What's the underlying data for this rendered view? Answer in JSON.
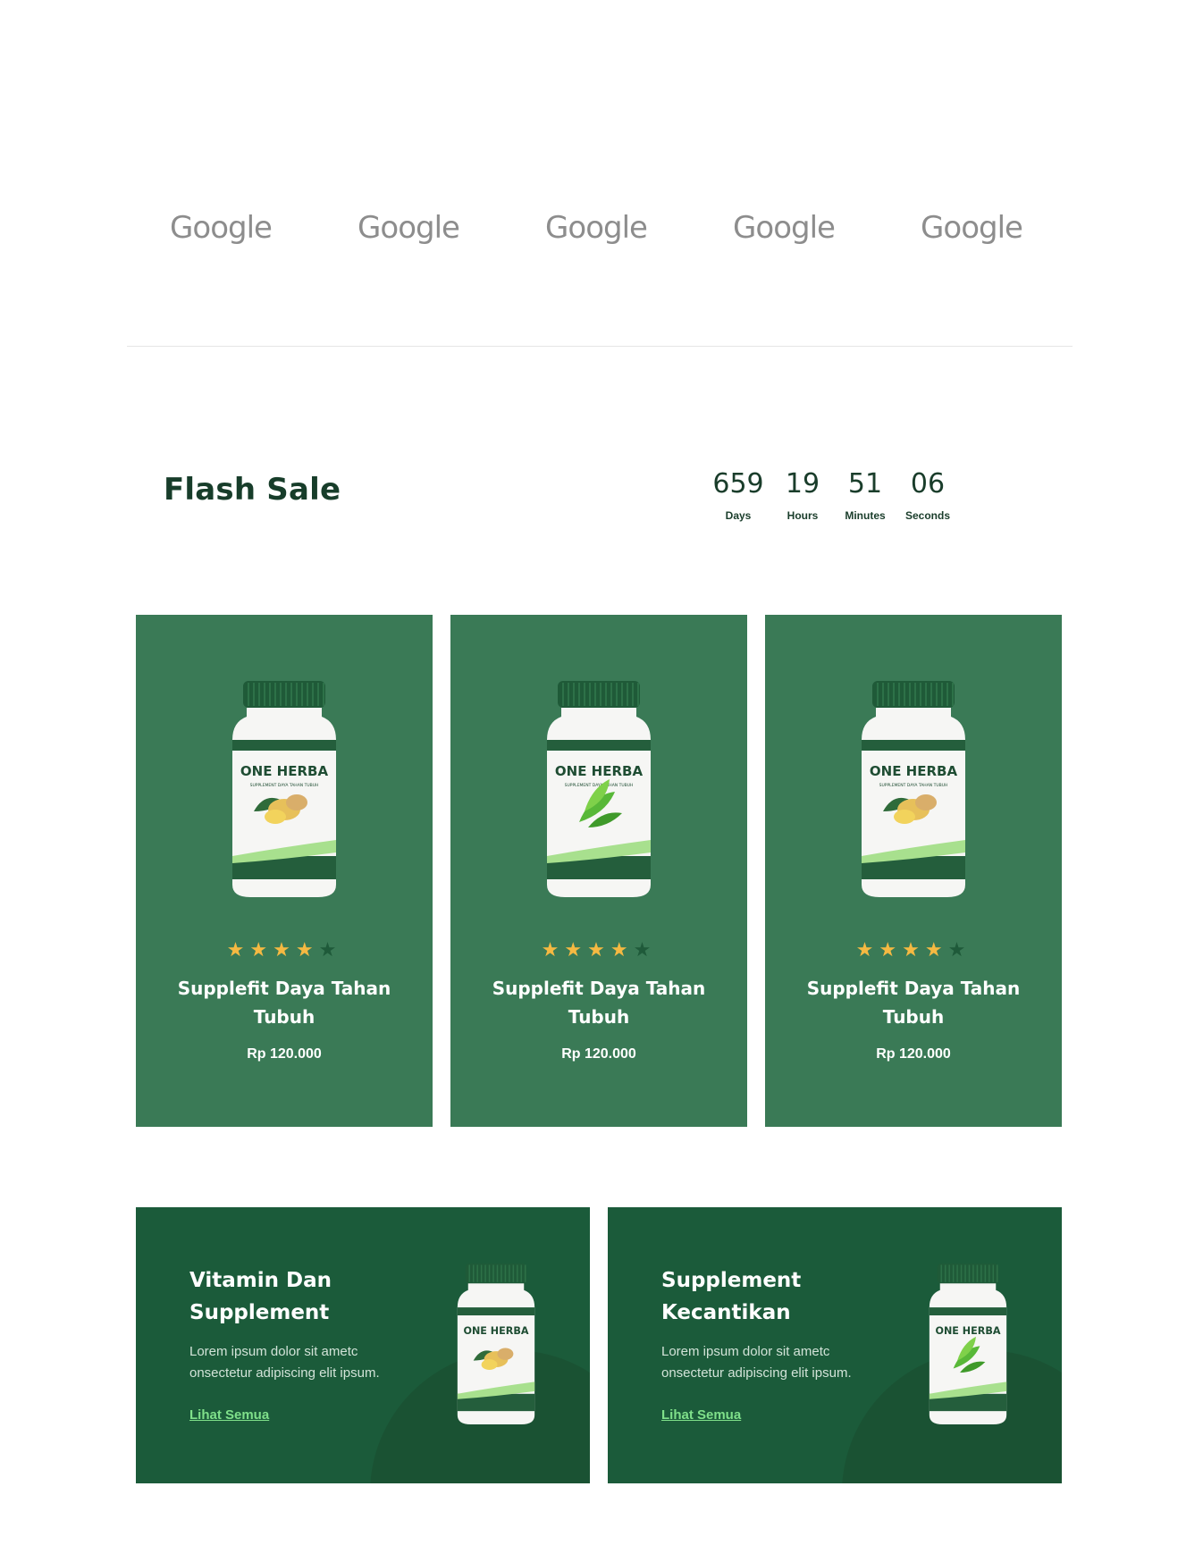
{
  "partners": {
    "logos": [
      "Google",
      "Google",
      "Google",
      "Google",
      "Google"
    ]
  },
  "flash_sale": {
    "title": "Flash Sale",
    "countdown": [
      {
        "value": "659",
        "label": "Days"
      },
      {
        "value": "19",
        "label": "Hours"
      },
      {
        "value": "51",
        "label": "Minutes"
      },
      {
        "value": "06",
        "label": "Seconds"
      }
    ]
  },
  "products": [
    {
      "name": "Supplefit Daya Tahan Tubuh",
      "price": "Rp 120.000",
      "rating": 4,
      "rating_max": 5,
      "bottle_brand": "ONE HERBA",
      "bottle_sub": "SUPPLEMENT DAYA TAHAN TUBUH",
      "illustration": "ginger-icon"
    },
    {
      "name": "Supplefit Daya Tahan Tubuh",
      "price": "Rp 120.000",
      "rating": 4,
      "rating_max": 5,
      "bottle_brand": "ONE HERBA",
      "bottle_sub": "SUPPLEMENT DAYA TAHAN TUBUH",
      "illustration": "leaf-icon"
    },
    {
      "name": "Supplefit Daya Tahan Tubuh",
      "price": "Rp 120.000",
      "rating": 4,
      "rating_max": 5,
      "bottle_brand": "ONE HERBA",
      "bottle_sub": "SUPPLEMENT DAYA TAHAN TUBUH",
      "illustration": "ginger-icon"
    }
  ],
  "promos": [
    {
      "title": "Vitamin Dan Supplement",
      "description": "Lorem ipsum dolor sit ametc onsectetur adipiscing elit ipsum.",
      "link": "Lihat Semua",
      "bottle_brand": "ONE HERBA",
      "illustration": "ginger-icon"
    },
    {
      "title": "Supplement Kecantikan",
      "description": "Lorem ipsum dolor sit ametc onsectetur adipiscing elit ipsum.",
      "link": "Lihat Semua",
      "bottle_brand": "ONE HERBA",
      "illustration": "leaf-icon"
    }
  ],
  "colors": {
    "card_green": "#3a7a56",
    "promo_green": "#1b5b3a",
    "title_dark": "#173d2a",
    "star": "#f5b942",
    "link": "#7fe08a"
  }
}
